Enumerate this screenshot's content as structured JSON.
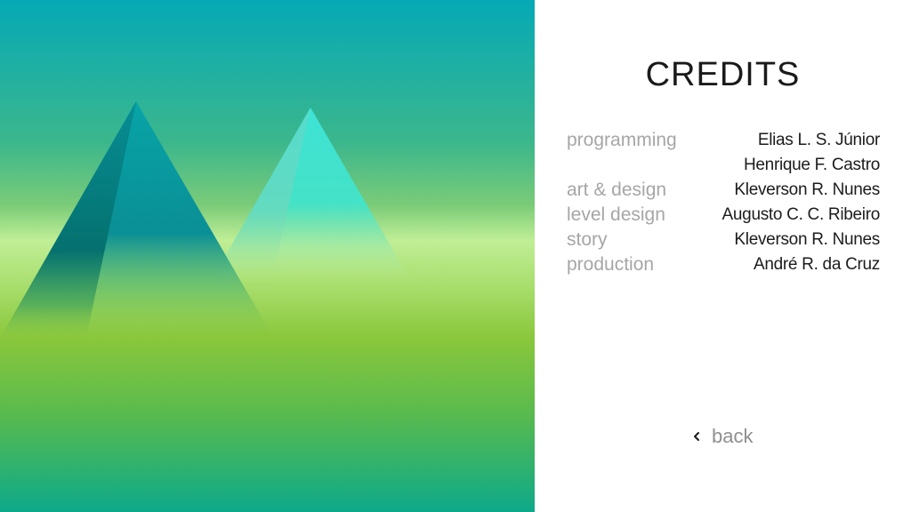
{
  "screen": {
    "title": "CREDITS",
    "colors": {
      "sky_top": "#05a9b6",
      "sky_band": "#b8eb97",
      "ground": "#8ac73c",
      "ground_bottom": "#13a986",
      "pyramid_dark": "#088e97",
      "pyramid_light": "#40e1d6"
    }
  },
  "credits": [
    {
      "role": "programming",
      "names": [
        "Elias L. S. Júnior",
        "Henrique F. Castro"
      ]
    },
    {
      "role": "art & design",
      "names": [
        "Kleverson R. Nunes"
      ]
    },
    {
      "role": "level design",
      "names": [
        "Augusto C. C. Ribeiro"
      ]
    },
    {
      "role": "story",
      "names": [
        "Kleverson R. Nunes"
      ]
    },
    {
      "role": "production",
      "names": [
        "André R. da Cruz"
      ]
    }
  ],
  "back": {
    "label": "back",
    "icon": "chevron-left-icon"
  }
}
